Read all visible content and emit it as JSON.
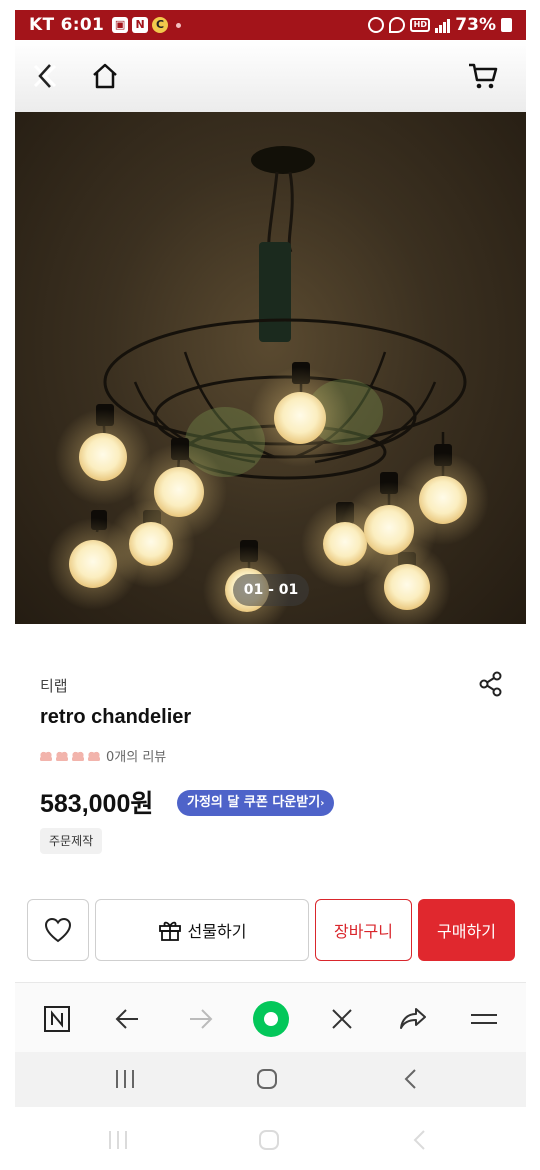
{
  "status_bar": {
    "carrier_time": "KT 6:01",
    "notif_icons": [
      "image-icon",
      "naver-icon",
      "coupang-icon"
    ],
    "battery": "73%"
  },
  "header": {
    "icons": [
      "close-back-icon",
      "home-icon",
      "cart-icon"
    ]
  },
  "hero": {
    "pager": "01 - 01"
  },
  "product": {
    "brand": "티랩",
    "title": "retro chandelier",
    "review_count": "0개의 리뷰",
    "price": "583,000원",
    "coupon": "가정의 달 쿠폰 다운받기",
    "tag": "주문제작"
  },
  "buy_bar": {
    "gift_label": "선물하기",
    "cart_label": "장바구니",
    "buy_label": "구매하기"
  },
  "colors": {
    "status_bar": "#a3141a",
    "primary_red": "#e0282e",
    "coupon_blue": "#4e63c9",
    "green_button": "#03c75a"
  }
}
